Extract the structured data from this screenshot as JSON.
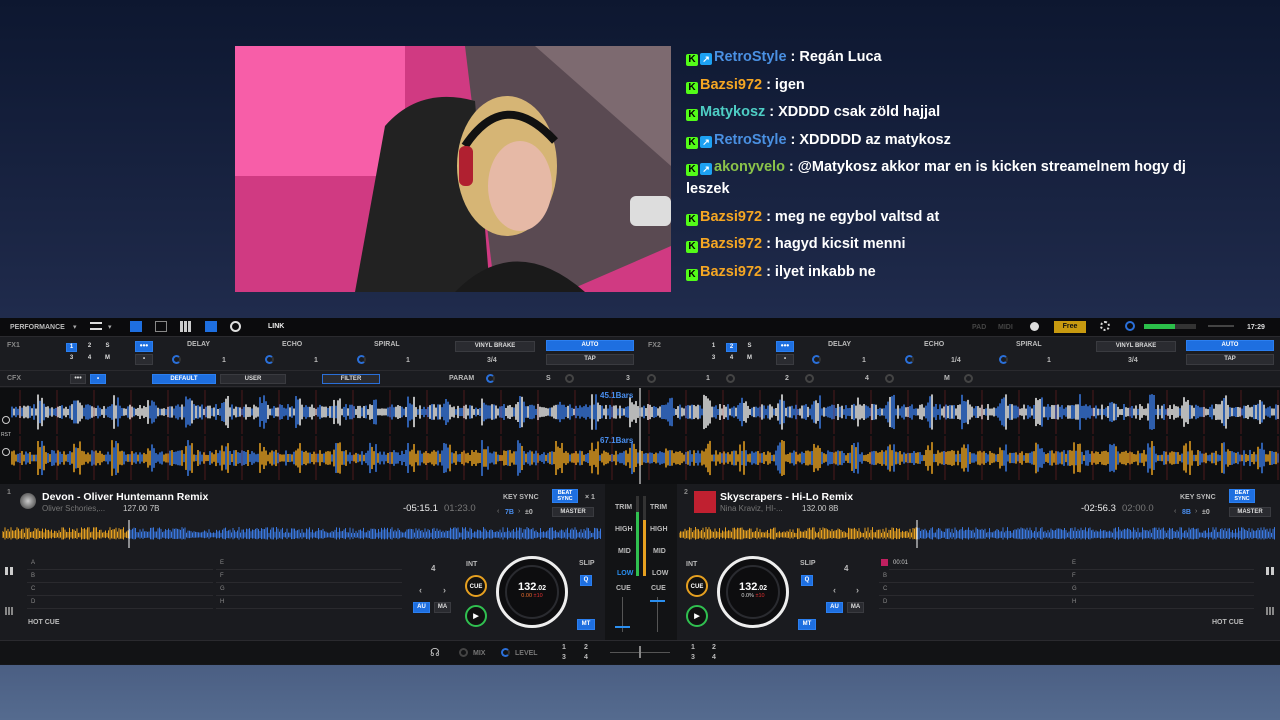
{
  "chat": [
    {
      "user": "RetroStyle",
      "color": "#4a90e2",
      "verified": true,
      "text": ": Regán Luca"
    },
    {
      "user": "Bazsi972",
      "color": "#f5a623",
      "verified": false,
      "text": ": igen"
    },
    {
      "user": "Matykosz",
      "color": "#4ecdc4",
      "verified": false,
      "text": ": XDDDD csak zöld hajjal"
    },
    {
      "user": "RetroStyle",
      "color": "#4a90e2",
      "verified": true,
      "text": ": XDDDDD az matykosz"
    },
    {
      "user": "akonyvelo",
      "color": "#8bc34a",
      "verified": true,
      "text": ": @Matykosz akkor mar en is kicken streamelnem hogy dj leszek"
    },
    {
      "user": "Bazsi972",
      "color": "#f5a623",
      "verified": false,
      "text": ": meg ne egybol valtsd at"
    },
    {
      "user": "Bazsi972",
      "color": "#f5a623",
      "verified": false,
      "text": ": hagyd kicsit menni"
    },
    {
      "user": "Bazsi972",
      "color": "#f5a623",
      "verified": false,
      "text": ": ilyet inkabb ne"
    }
  ],
  "topbar": {
    "mode": "PERFORMANCE",
    "link": "LINK",
    "pad": "PAD",
    "midi": "MIDI",
    "free": "Free",
    "time": "17:29"
  },
  "fx1": {
    "label": "FX1",
    "beats": [
      "1",
      "2",
      "S",
      "3",
      "4",
      "M"
    ],
    "slots": [
      "DELAY",
      "ECHO",
      "SPIRAL"
    ],
    "slot_vals": [
      "1",
      "1",
      "1"
    ],
    "brake": "VINYL BRAKE",
    "brake_val": "3/4",
    "auto": "AUTO",
    "tap": "TAP"
  },
  "fx2": {
    "label": "FX2",
    "beats": [
      "1",
      "2",
      "S",
      "3",
      "4",
      "M"
    ],
    "slots": [
      "DELAY",
      "ECHO",
      "SPIRAL"
    ],
    "slot_vals": [
      "1",
      "1/4",
      "1"
    ],
    "brake": "VINYL BRAKE",
    "brake_val": "3/4",
    "auto": "AUTO",
    "tap": "TAP"
  },
  "cfx": {
    "label": "CFX",
    "tabs": [
      "DEFAULT",
      "USER"
    ],
    "filter": "FILTER",
    "param": "PARAM",
    "s": "S",
    "n3": "3",
    "n1": "1",
    "n2": "2",
    "n4": "4",
    "m": "M"
  },
  "waves": {
    "bars1": "45.1Bars",
    "bars2": "67.1Bars",
    "rst": "RST"
  },
  "deck1": {
    "num": "1",
    "title": "Devon - Oliver Huntemann Remix",
    "artist": "Oliver Schories,...",
    "bpm_key": "127.00 7B",
    "remain": "-05:15.1",
    "elapsed": "01:23.0",
    "keysync": "KEY SYNC",
    "beatsync": "BEAT SYNC",
    "x1": "× 1",
    "key": "7B",
    "pm": "±0",
    "master": "MASTER",
    "pads": [
      "A",
      "B",
      "C",
      "D",
      "E",
      "F",
      "G",
      "H"
    ],
    "hotcue": "HOT CUE",
    "loop": "4",
    "int": "INT",
    "slip": "SLIP",
    "q": "Q",
    "au": "AU",
    "ma": "MA",
    "mt": "MT",
    "cue": "CUE",
    "jog_bpm": "132",
    "jog_dec": ".02",
    "jog_pct": "0.00",
    "jog_red": "±10"
  },
  "deck2": {
    "num": "2",
    "title": "Skyscrapers - Hi-Lo Remix",
    "artist": "Nina Kraviz, HI-...",
    "bpm_key": "132.00 8B",
    "remain": "-02:56.3",
    "elapsed": "02:00.0",
    "keysync": "KEY SYNC",
    "beatsync": "BEAT SYNC",
    "key": "8B",
    "pm": "±0",
    "master": "MASTER",
    "pads": [
      "00:01",
      "B",
      "C",
      "D",
      "E",
      "F",
      "G",
      "H"
    ],
    "hotcue": "HOT CUE",
    "loop": "4",
    "int": "INT",
    "slip": "SLIP",
    "q": "Q",
    "au": "AU",
    "ma": "MA",
    "mt": "MT",
    "cue": "CUE",
    "jog_bpm": "132",
    "jog_dec": ".02",
    "jog_pct": "0.0%",
    "jog_red": "±10"
  },
  "mixer": {
    "trim": "TRIM",
    "high": "HIGH",
    "mid": "MID",
    "low": "LOW",
    "cue": "CUE",
    "mix": "MIX",
    "level": "LEVEL"
  },
  "bottom": {
    "n1": "1",
    "n2": "2",
    "n3": "3",
    "n4": "4"
  }
}
